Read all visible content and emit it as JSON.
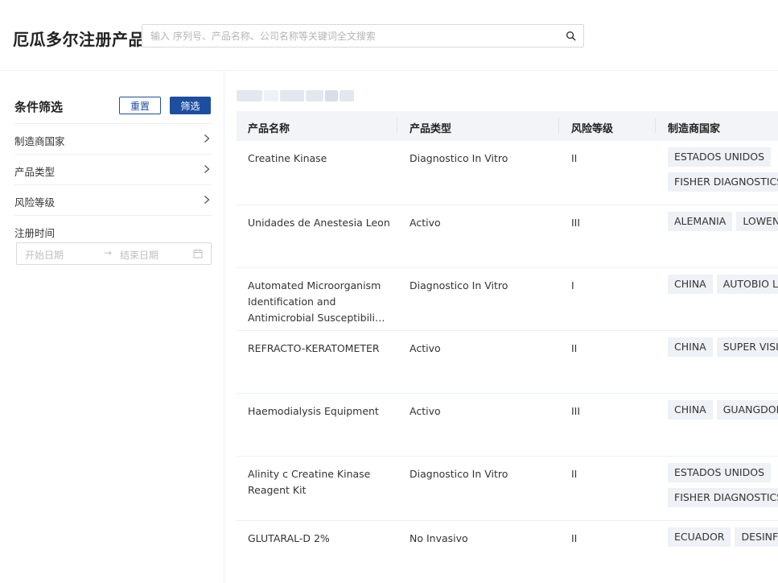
{
  "header": {
    "brand": "厄瓜多尔注册产品",
    "search_placeholder": "输入 序列号、产品名称、公司名称等关键词全文搜索"
  },
  "sidebar": {
    "title": "条件筛选",
    "reset_label": "重置",
    "filter_label": "筛选",
    "items": [
      {
        "label": "制造商国家"
      },
      {
        "label": "产品类型"
      },
      {
        "label": "风险等级"
      }
    ],
    "date": {
      "label": "注册时间",
      "start_placeholder": "开始日期",
      "end_placeholder": "结束日期"
    }
  },
  "table": {
    "headers": [
      "产品名称",
      "产品类型",
      "风险等级",
      "制造商国家"
    ],
    "rows": [
      {
        "name": "Creatine Kinase",
        "type": "Diagnostico In Vitro",
        "risk": "II",
        "country": "ESTADOS UNIDOS",
        "company": "FISHER DIAGNOSTICS"
      },
      {
        "name": "Unidades de Anestesia Leon",
        "type": "Activo",
        "risk": "III",
        "country": "ALEMANIA",
        "company": "LOWENSTEIN"
      },
      {
        "name": "Automated Microorganism Identification and Antimicrobial Susceptibili…",
        "type": "Diagnostico In Vitro",
        "risk": "I",
        "country": "CHINA",
        "company": "AUTOBIO LABTEC"
      },
      {
        "name": "REFRACTO-KERATOMETER",
        "type": "Activo",
        "risk": "II",
        "country": "CHINA",
        "company": "SUPER VISION"
      },
      {
        "name": "Haemodialysis Equipment",
        "type": "Activo",
        "risk": "III",
        "country": "CHINA",
        "company": "GUANGDONG"
      },
      {
        "name": "Alinity c Creatine Kinase Reagent Kit",
        "type": "Diagnostico In Vitro",
        "risk": "II",
        "country": "ESTADOS UNIDOS",
        "company": "FISHER DIAGNOSTICS"
      },
      {
        "name": "GLUTARAL-D 2%",
        "type": "No Invasivo",
        "risk": "II",
        "country": "ECUADOR",
        "company": "DESINFECTANTES"
      }
    ]
  }
}
